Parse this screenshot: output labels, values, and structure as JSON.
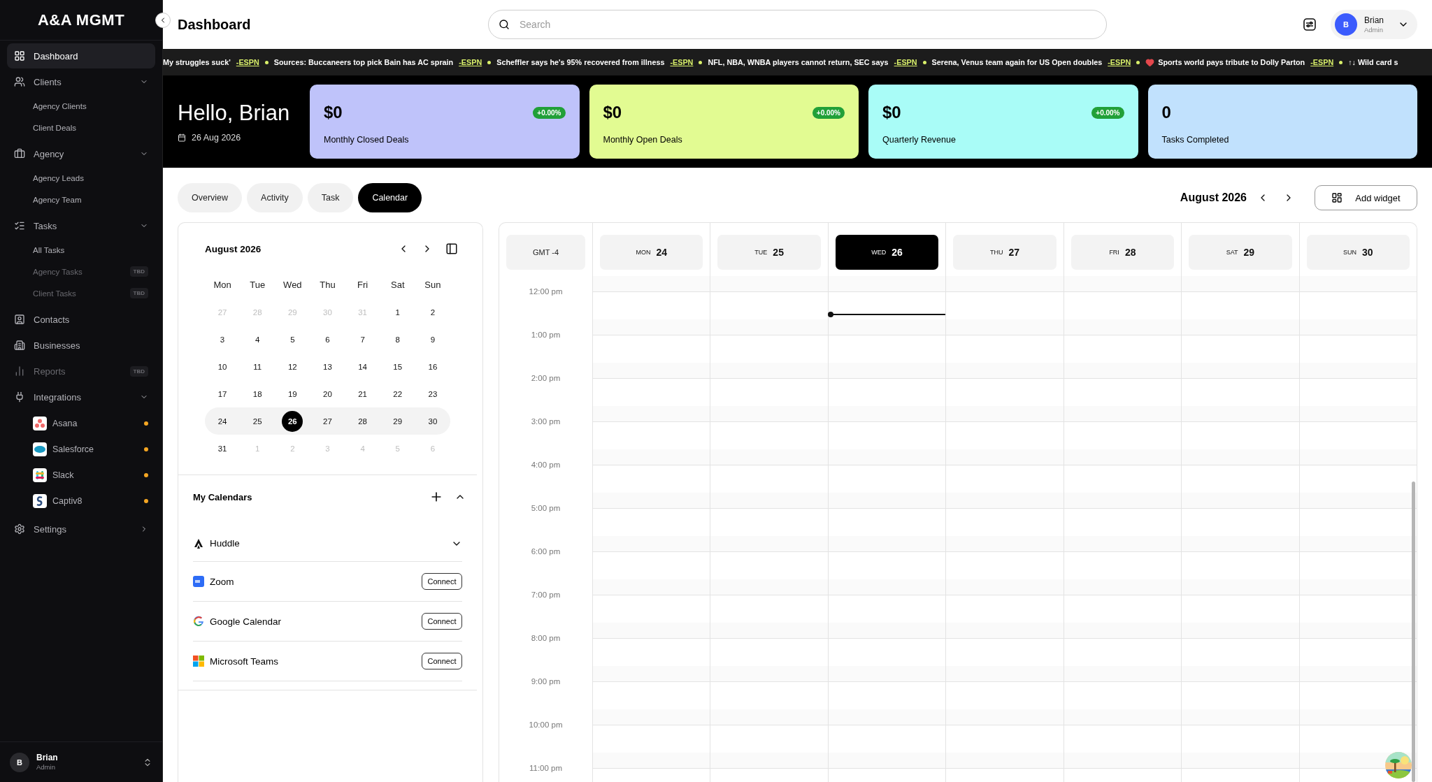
{
  "sidebar": {
    "logo": "A&A MGMT",
    "items": [
      {
        "label": "Dashboard",
        "selected": true,
        "disabled": false
      },
      {
        "label": "Clients",
        "selected": false,
        "disabled": false,
        "expanded": true,
        "children": [
          {
            "label": "Agency Clients",
            "selected": false,
            "disabled": false
          },
          {
            "label": "Client Deals",
            "selected": false,
            "disabled": false
          }
        ]
      },
      {
        "label": "Agency",
        "selected": false,
        "disabled": false,
        "expanded": true,
        "children": [
          {
            "label": "Agency Leads",
            "selected": false,
            "disabled": false
          },
          {
            "label": "Agency Team",
            "selected": false,
            "disabled": false
          }
        ]
      },
      {
        "label": "Tasks",
        "selected": false,
        "disabled": false,
        "expanded": true,
        "children": [
          {
            "label": "All Tasks",
            "selected": false,
            "disabled": false
          },
          {
            "label": "Agency Tasks",
            "selected": false,
            "disabled": true,
            "badge": "TBD"
          },
          {
            "label": "Client Tasks",
            "selected": false,
            "disabled": true,
            "badge": "TBD"
          }
        ]
      },
      {
        "label": "Contacts",
        "selected": false,
        "disabled": false
      },
      {
        "label": "Businesses",
        "selected": false,
        "disabled": false
      },
      {
        "label": "Reports",
        "selected": false,
        "disabled": true,
        "badge": "TBD"
      },
      {
        "label": "Integrations",
        "selected": false,
        "disabled": false,
        "expanded": true,
        "children": [
          {
            "label": "Asana",
            "selected": false,
            "disabled": false,
            "color": "#f5a623"
          },
          {
            "label": "Salesforce",
            "selected": false,
            "disabled": false,
            "color": "#f5a623"
          },
          {
            "label": "Slack",
            "selected": false,
            "disabled": false,
            "color": "#f5a623"
          },
          {
            "label": "Captiv8",
            "selected": false,
            "disabled": false,
            "color": "#f5a623"
          }
        ]
      },
      {
        "label": "Settings",
        "selected": false,
        "disabled": false,
        "expanded": false
      }
    ],
    "user": {
      "initial": "B",
      "name": "Brian",
      "role": "Admin"
    }
  },
  "header": {
    "title": "Dashboard",
    "search": {
      "placeholder": "Search"
    },
    "user": {
      "initial": "B",
      "name": "Brian",
      "role": "Admin"
    }
  },
  "ticker": [
    {
      "kind": "plain",
      "text": "My struggles suck'",
      "source": "-ESPN"
    },
    {
      "kind": "plain",
      "text": "Sources: Buccaneers top pick Bain has AC sprain",
      "source": "-ESPN"
    },
    {
      "kind": "plain",
      "text": "Scheffler says he's 95% recovered from illness",
      "source": "-ESPN"
    },
    {
      "kind": "plain",
      "text": "NFL, NBA, WNBA players cannot return, SEC says",
      "source": "-ESPN"
    },
    {
      "kind": "plain",
      "text": "Serena, Venus team again for US Open doubles",
      "source": "-ESPN"
    },
    {
      "kind": "heart",
      "text": "Sports world pays tribute to Dolly Parton",
      "source": "-ESPN"
    },
    {
      "kind": "plain",
      "text": "↑↓ Wild card s"
    }
  ],
  "hero": {
    "greeting": "Hello, Brian",
    "date": "26 Aug 2026",
    "cards": [
      {
        "value": "$0",
        "change": "+0.00%",
        "label": "Monthly Closed Deals",
        "color": "#bfc3fa"
      },
      {
        "value": "$0",
        "change": "+0.00%",
        "label": "Monthly Open Deals",
        "color": "#e2fb92"
      },
      {
        "value": "$0",
        "change": "+0.00%",
        "label": "Quarterly Revenue",
        "color": "#a9fcf7"
      },
      {
        "value": "0",
        "label": "Tasks Completed",
        "color": "#c1e1fd"
      }
    ]
  },
  "tabs": [
    {
      "label": "Overview",
      "selected": false
    },
    {
      "label": "Activity",
      "selected": false
    },
    {
      "label": "Task",
      "selected": false
    },
    {
      "label": "Calendar",
      "selected": true
    }
  ],
  "week_nav": {
    "title": "August 2026",
    "button": "Add widget"
  },
  "mini_calendar": {
    "title": "August 2026",
    "weekdays": [
      "Mon",
      "Tue",
      "Wed",
      "Thu",
      "Fri",
      "Sat",
      "Sun"
    ],
    "weeks": [
      {
        "highlighted": false,
        "days": [
          {
            "day": "27",
            "muted": true,
            "selected": false
          },
          {
            "day": "28",
            "muted": true,
            "selected": false
          },
          {
            "day": "29",
            "muted": true,
            "selected": false
          },
          {
            "day": "30",
            "muted": true,
            "selected": false
          },
          {
            "day": "31",
            "muted": true,
            "selected": false
          },
          {
            "day": "1",
            "muted": false,
            "selected": false
          },
          {
            "day": "2",
            "muted": false,
            "selected": false
          }
        ]
      },
      {
        "highlighted": false,
        "days": [
          {
            "day": "3",
            "muted": false,
            "selected": false
          },
          {
            "day": "4",
            "muted": false,
            "selected": false
          },
          {
            "day": "5",
            "muted": false,
            "selected": false
          },
          {
            "day": "6",
            "muted": false,
            "selected": false
          },
          {
            "day": "7",
            "muted": false,
            "selected": false
          },
          {
            "day": "8",
            "muted": false,
            "selected": false
          },
          {
            "day": "9",
            "muted": false,
            "selected": false
          }
        ]
      },
      {
        "highlighted": false,
        "days": [
          {
            "day": "10",
            "muted": false,
            "selected": false
          },
          {
            "day": "11",
            "muted": false,
            "selected": false
          },
          {
            "day": "12",
            "muted": false,
            "selected": false
          },
          {
            "day": "13",
            "muted": false,
            "selected": false
          },
          {
            "day": "14",
            "muted": false,
            "selected": false
          },
          {
            "day": "15",
            "muted": false,
            "selected": false
          },
          {
            "day": "16",
            "muted": false,
            "selected": false
          }
        ]
      },
      {
        "highlighted": false,
        "days": [
          {
            "day": "17",
            "muted": false,
            "selected": false
          },
          {
            "day": "18",
            "muted": false,
            "selected": false
          },
          {
            "day": "19",
            "muted": false,
            "selected": false
          },
          {
            "day": "20",
            "muted": false,
            "selected": false
          },
          {
            "day": "21",
            "muted": false,
            "selected": false
          },
          {
            "day": "22",
            "muted": false,
            "selected": false
          },
          {
            "day": "23",
            "muted": false,
            "selected": false
          }
        ]
      },
      {
        "highlighted": true,
        "days": [
          {
            "day": "24",
            "muted": false,
            "selected": false
          },
          {
            "day": "25",
            "muted": false,
            "selected": false
          },
          {
            "day": "26",
            "muted": false,
            "selected": true
          },
          {
            "day": "27",
            "muted": false,
            "selected": false
          },
          {
            "day": "28",
            "muted": false,
            "selected": false
          },
          {
            "day": "29",
            "muted": false,
            "selected": false
          },
          {
            "day": "30",
            "muted": false,
            "selected": false
          }
        ]
      },
      {
        "highlighted": false,
        "days": [
          {
            "day": "31",
            "muted": false,
            "selected": false
          },
          {
            "day": "1",
            "muted": true,
            "selected": false
          },
          {
            "day": "2",
            "muted": true,
            "selected": false
          },
          {
            "day": "3",
            "muted": true,
            "selected": false
          },
          {
            "day": "4",
            "muted": true,
            "selected": false
          },
          {
            "day": "5",
            "muted": true,
            "selected": false
          },
          {
            "day": "6",
            "muted": true,
            "selected": false
          }
        ]
      }
    ]
  },
  "my_calendars": {
    "title": "My Calendars",
    "expanded": true,
    "items": [
      {
        "kind": "expand",
        "name": "Huddle",
        "expanded": false
      },
      {
        "kind": "connect",
        "name": "Zoom",
        "button": "Connect"
      },
      {
        "kind": "connect",
        "name": "Google Calendar",
        "button": "Connect"
      },
      {
        "kind": "connect",
        "name": "Microsoft Teams",
        "button": "Connect"
      }
    ]
  },
  "week_view": {
    "timezone": "GMT -4",
    "days": [
      {
        "dow": "MON",
        "date": "24",
        "selected": false
      },
      {
        "dow": "TUE",
        "date": "25",
        "selected": false
      },
      {
        "dow": "WED",
        "date": "26",
        "selected": true
      },
      {
        "dow": "THU",
        "date": "27",
        "selected": false
      },
      {
        "dow": "FRI",
        "date": "28",
        "selected": false
      },
      {
        "dow": "SAT",
        "date": "29",
        "selected": false
      },
      {
        "dow": "SUN",
        "date": "30",
        "selected": false
      }
    ],
    "hours": [
      "12:00 pm",
      "1:00 pm",
      "2:00 pm",
      "3:00 pm",
      "4:00 pm",
      "5:00 pm",
      "6:00 pm",
      "7:00 pm",
      "8:00 pm",
      "9:00 pm",
      "10:00 pm",
      "11:00 pm"
    ]
  }
}
